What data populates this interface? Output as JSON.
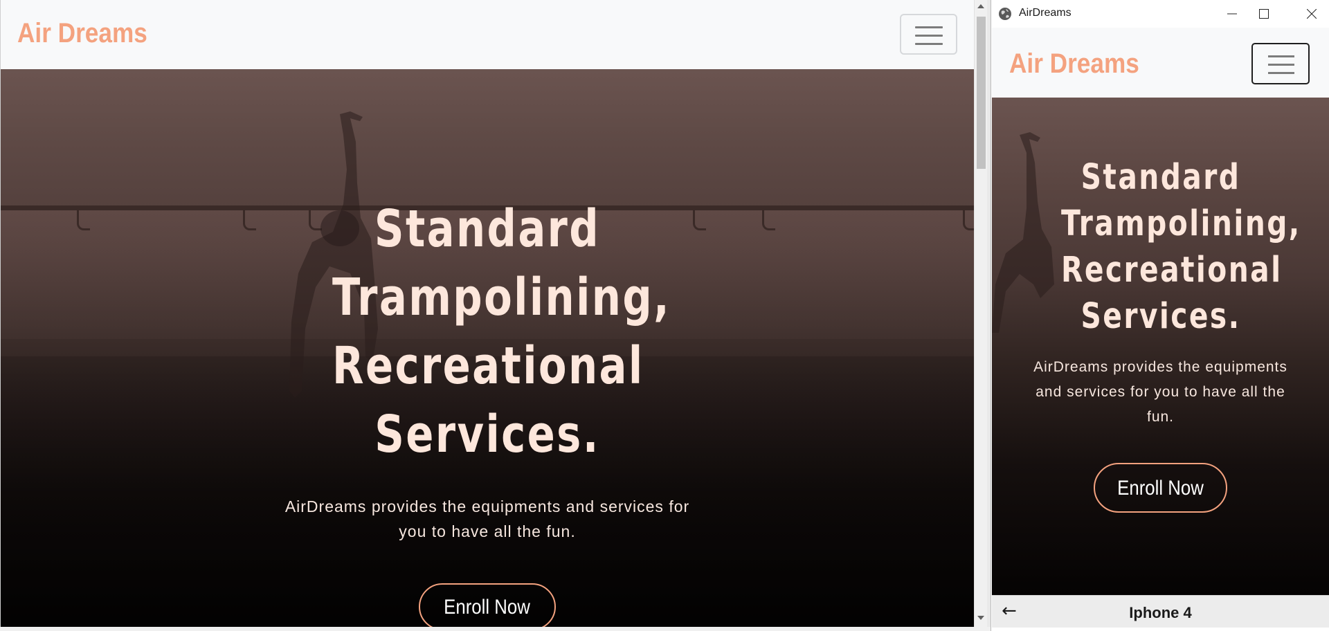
{
  "main": {
    "brand": "Air Dreams",
    "hero": {
      "title_lines": [
        "Standard",
        "Trampolining,",
        "Recreational",
        "Services."
      ],
      "description": "AirDreams provides the equipments and services for you to have all the fun.",
      "cta": "Enroll Now"
    }
  },
  "emulator": {
    "window_title": "AirDreams",
    "brand": "Air Dreams",
    "hero": {
      "title_lines": [
        "Standard",
        "Trampolining,",
        "Recreational",
        "Services."
      ],
      "description": "AirDreams provides the equipments and services for you to have all the fun.",
      "cta": "Enroll Now"
    },
    "back_icon": "←",
    "device_name": "Iphone 4"
  },
  "colors": {
    "brand": "#f4a27f",
    "hero_title": "#fde7dc",
    "navbar_bg": "#f8f9fa"
  },
  "icons": {
    "toggler": "hamburger-icon",
    "window_app": "globe-icon",
    "minimize": "minimize-icon",
    "maximize": "maximize-icon",
    "close": "close-icon",
    "back": "back-arrow-icon"
  }
}
